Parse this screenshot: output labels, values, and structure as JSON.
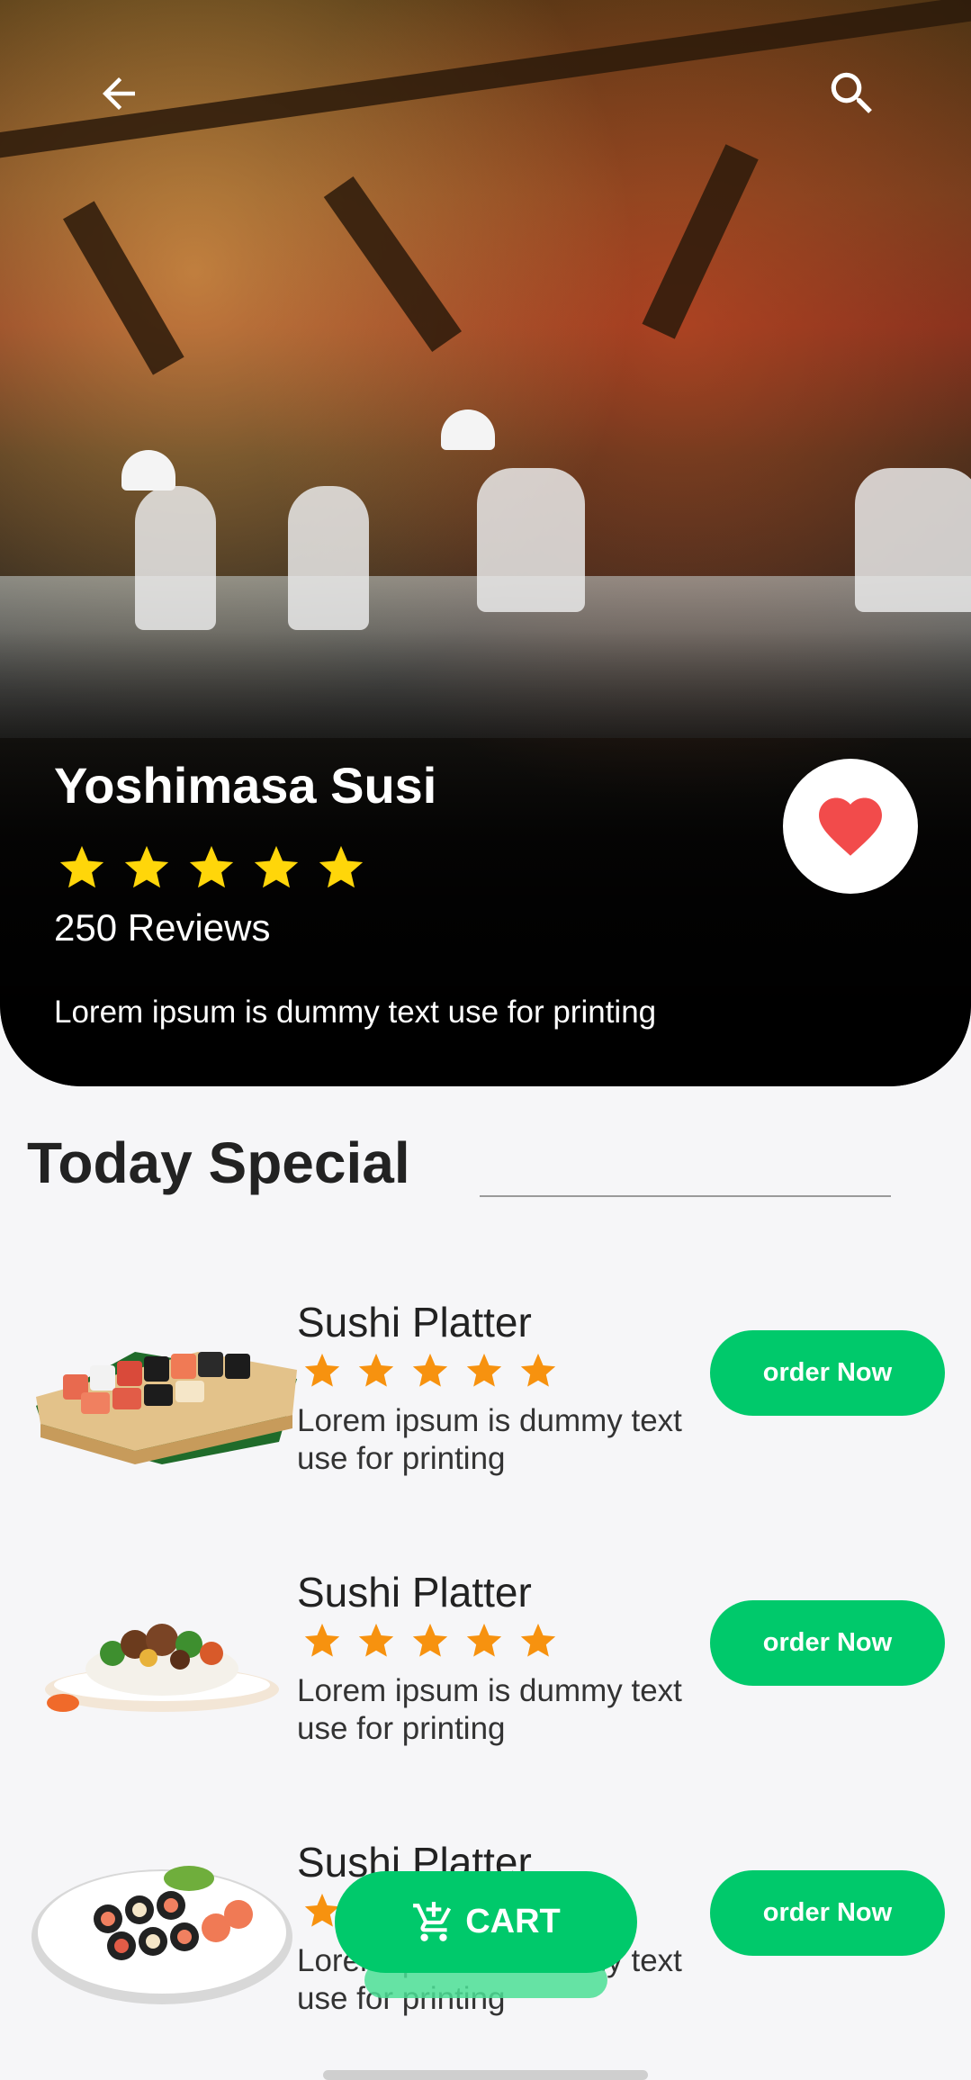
{
  "header": {
    "back_icon": "arrow-left-icon",
    "search_icon": "search-icon"
  },
  "restaurant": {
    "name": "Yoshimasa Susi",
    "rating": 5,
    "reviews": "250 Reviews",
    "description": "Lorem ipsum is dummy text use for printing",
    "favorite_icon": "heart-icon"
  },
  "section": {
    "title": "Today Special"
  },
  "menu_items": [
    {
      "title": "Sushi Platter",
      "rating": 5,
      "description": "Lorem ipsum is dummy text use for printing",
      "button": "order Now",
      "image": "sushi-board-image"
    },
    {
      "title": "Sushi Platter",
      "rating": 5,
      "description": "Lorem ipsum is dummy text use for printing",
      "button": "order Now",
      "image": "rice-plate-image"
    },
    {
      "title": "Sushi Platter",
      "rating": 5,
      "description": "Lorem ipsum is dummy text use for printing",
      "button": "order Now",
      "image": "sushi-rolls-plate-image"
    }
  ],
  "cart": {
    "label": "CART",
    "icon": "cart-plus-icon"
  },
  "colors": {
    "accent_green": "#00c96b",
    "star_yellow": "#FFD60A",
    "star_orange": "#F7920F",
    "heart_red": "#F24B4B"
  }
}
